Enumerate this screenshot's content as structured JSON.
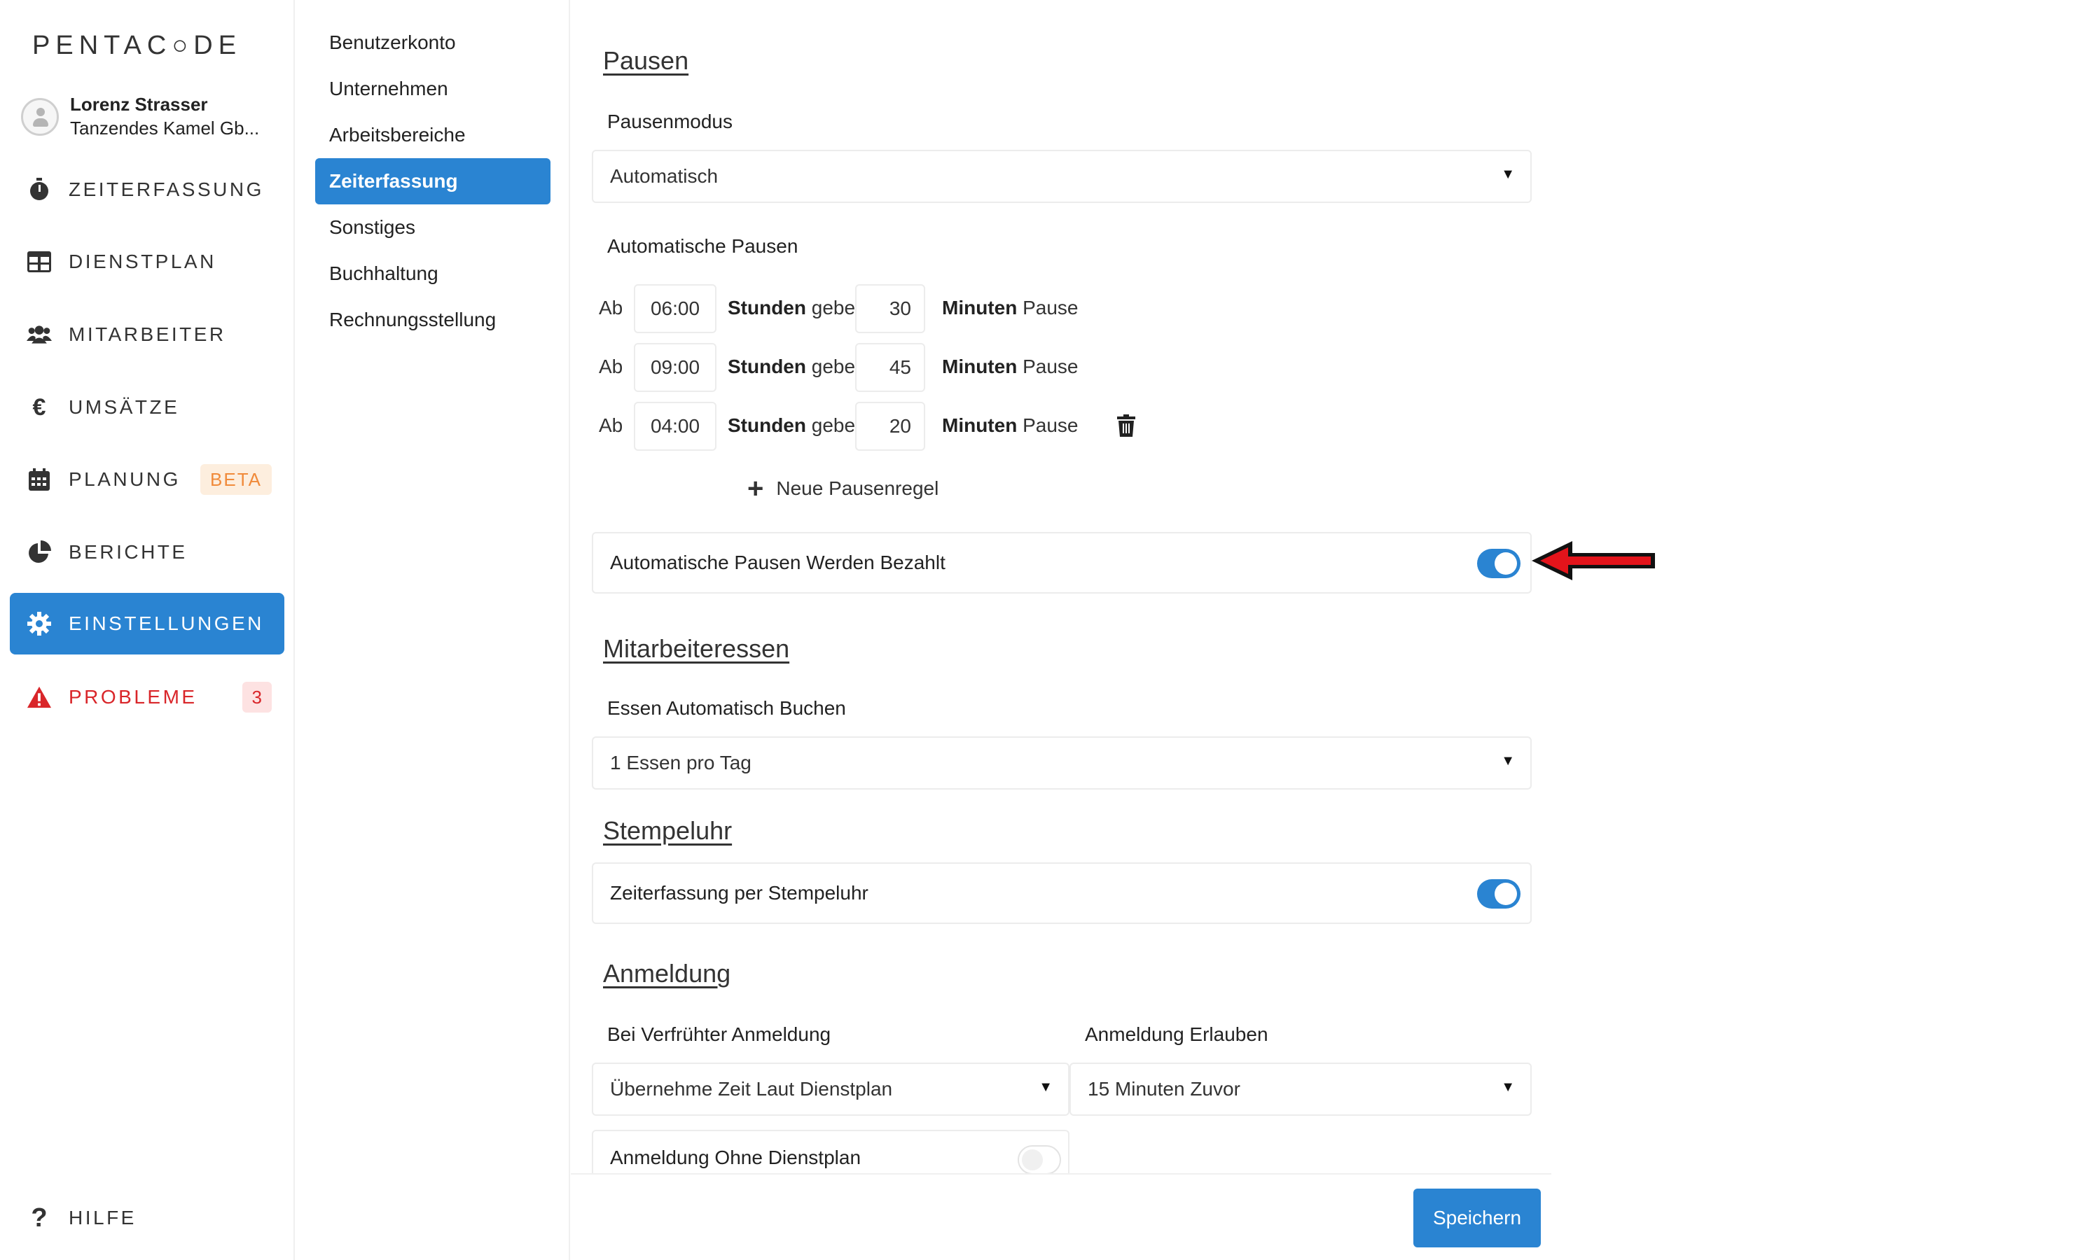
{
  "brand": {
    "logo_text": "PENTAC○DE"
  },
  "user": {
    "name": "Lorenz Strasser",
    "company": "Tanzendes Kamel Gb..."
  },
  "sidebar": {
    "items": [
      {
        "label": "ZEITERFASSUNG",
        "icon": "stopwatch-icon"
      },
      {
        "label": "DIENSTPLAN",
        "icon": "table-icon"
      },
      {
        "label": "MITARBEITER",
        "icon": "users-icon"
      },
      {
        "label": "UMSÄTZE",
        "icon": "euro-icon"
      },
      {
        "label": "PLANUNG",
        "icon": "calendar-icon",
        "badge": "BETA"
      },
      {
        "label": "BERICHTE",
        "icon": "pie-chart-icon"
      },
      {
        "label": "EINSTELLUNGEN",
        "icon": "gear-icon",
        "active": true
      },
      {
        "label": "PROBLEME",
        "icon": "warning-icon",
        "badge": "3"
      }
    ],
    "help": {
      "label": "HILFE",
      "icon": "question-icon"
    }
  },
  "submenu": {
    "items": [
      {
        "label": "Benutzerkonto"
      },
      {
        "label": "Unternehmen"
      },
      {
        "label": "Arbeitsbereiche"
      },
      {
        "label": "Zeiterfassung",
        "active": true
      },
      {
        "label": "Sonstiges"
      },
      {
        "label": "Buchhaltung"
      },
      {
        "label": "Rechnungsstellung"
      }
    ]
  },
  "pausen": {
    "title": "Pausen",
    "mode_label": "Pausenmodus",
    "mode_value": "Automatisch",
    "auto_label": "Automatische Pausen",
    "rule_words": {
      "ab": "Ab",
      "stunden": "Stunden",
      "gebe": "gebe",
      "minuten": "Minuten",
      "pause": "Pause"
    },
    "rules": [
      {
        "time": "06:00",
        "minutes": "30"
      },
      {
        "time": "09:00",
        "minutes": "45"
      },
      {
        "time": "04:00",
        "minutes": "20"
      }
    ],
    "add_rule_label": "Neue Pausenregel",
    "paid_label": "Automatische Pausen Werden Bezahlt",
    "paid_enabled": true
  },
  "essen": {
    "title": "Mitarbeiteressen",
    "label": "Essen Automatisch Buchen",
    "value": "1 Essen pro Tag"
  },
  "stempeluhr": {
    "title": "Stempeluhr",
    "label": "Zeiterfassung per Stempeluhr",
    "enabled": true
  },
  "anmeldung": {
    "title": "Anmeldung",
    "early_label": "Bei Verfrühter Anmeldung",
    "early_value": "Übernehme Zeit Laut Dienstplan",
    "allow_label": "Anmeldung Erlauben",
    "allow_value": "15 Minuten Zuvor",
    "without_plan_label": "Anmeldung Ohne Dienstplan",
    "without_plan_enabled": false
  },
  "footer": {
    "save_label": "Speichern"
  },
  "colors": {
    "accent": "#2a84d2",
    "danger": "#d9262a",
    "beta": "#f08a3a",
    "arrow": "#e3141b"
  }
}
